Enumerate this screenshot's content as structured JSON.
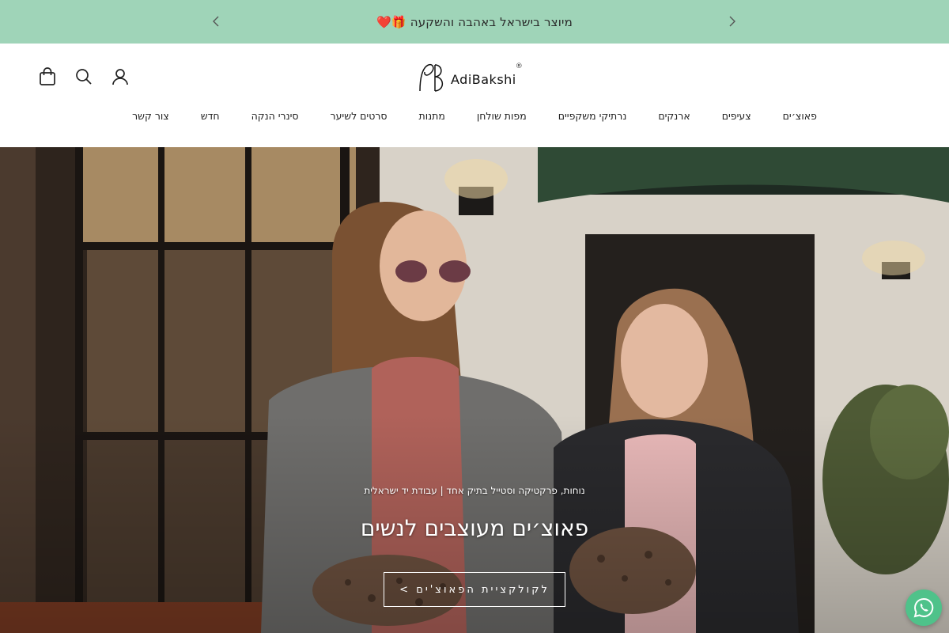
{
  "announcement": {
    "text": "מיוצר בישראל באהבה והשקעה 🎁❤️",
    "prev_icon": "chevron-left-icon",
    "next_icon": "chevron-right-icon"
  },
  "header": {
    "logo_text": "AdiBakshi",
    "logo_mark": "®",
    "icons": [
      "bag-icon",
      "search-icon",
      "user-icon"
    ]
  },
  "nav": {
    "items": [
      "פאוצ׳ים",
      "צעיפים",
      "ארנקים",
      "נרתיקי משקפיים",
      "מפות שולחן",
      "מתנות",
      "סרטים לשיער",
      "סינרי הנקה",
      "חדש",
      "צור קשר"
    ]
  },
  "hero": {
    "subtitle": "נוחות, פרקטיקה וסטייל בתיק אחד | עבודת יד ישראלית",
    "title": "פאוצ׳ים מעוצבים לנשים",
    "cta_label": "לקולקציית הפאוצ'ים >"
  },
  "colors": {
    "announcement_bg": "#9fd4b8",
    "whatsapp": "#4fc28a"
  }
}
